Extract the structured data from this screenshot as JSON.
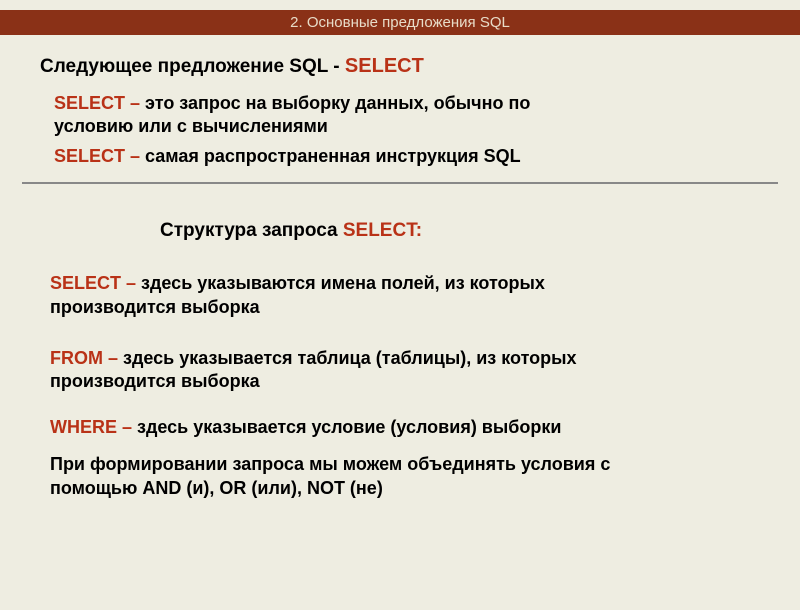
{
  "header": "2. Основные предложения SQL",
  "intro": {
    "prefix": "Следующее предложение SQL - ",
    "keyword": "SELECT"
  },
  "definitions": [
    {
      "keyword": "SELECT – ",
      "text": "это запрос на выборку данных, обычно по условию или с вычислениями"
    },
    {
      "keyword": "SELECT – ",
      "text": "самая распространенная инструкция SQL"
    }
  ],
  "structure": {
    "title_prefix": "Структура запроса ",
    "title_keyword": "SELECT:"
  },
  "clauses": [
    {
      "keyword": "SELECT – ",
      "text": "здесь указываются имена полей, из которых производится выборка"
    },
    {
      "keyword": "FROM – ",
      "text": "здесь указывается таблица (таблицы), из которых производится выборка"
    },
    {
      "keyword": "WHERE – ",
      "text": "здесь указывается условие (условия) выборки"
    }
  ],
  "note": "При формировании запроса мы можем объединять условия с помощью AND (и), OR (или), NOT (не)"
}
